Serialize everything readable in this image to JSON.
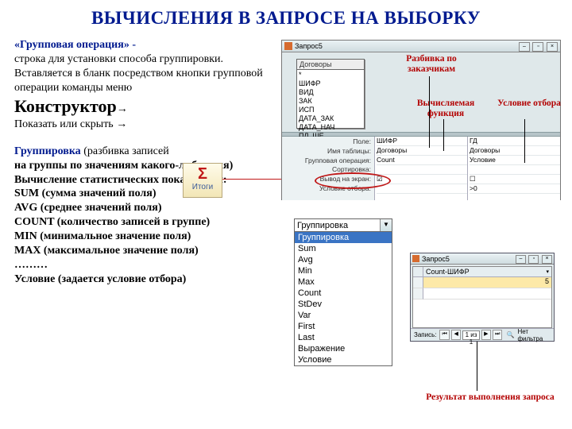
{
  "title": "ВЫЧИСЛЕНИЯ В ЗАПРОСЕ НА ВЫБОРКУ",
  "left": {
    "p1_b": "«Групповая операция» -",
    "p1": "строка для установки способа группировки.",
    "p2": "Вставляется в бланк посредством кнопки групповой операции команды меню",
    "konstructor": "Конструктор",
    "show_hide": "Показать или скрыть",
    "group_b": "Группировка",
    "group_paren": "(разбивка записей",
    "group_cont": "на группы по значениям какого-либо поля)",
    "stat_hdr": "Вычисление статистических показателей:",
    "sum": "SUM (сумма значений поля)",
    "avg": "AVG (среднее значений поля)",
    "count": "COUNT (количество записей в группе)",
    "min": "MIN (минимальное значение поля)",
    "max": "MAX (максимальное значение поля)",
    "dots": "………",
    "cond": "Условие (задается условие отбора)"
  },
  "itogi": {
    "sigma": "Σ",
    "label": "Итоги"
  },
  "app": {
    "title": "Запрос5",
    "fieldbox_title": "Договоры",
    "fields": [
      "*",
      "ШИФР",
      "ВИД",
      "ЗАК",
      "ИСП",
      "ДАТА_ЗАК",
      "ДАТА_НАЧ",
      "ПЛ_ШЕ"
    ],
    "rowlabels": [
      "Поле:",
      "Имя таблицы:",
      "Групповая операция:",
      "Сортировка:",
      "Вывод на экран:",
      "Условие отбора:"
    ],
    "col1": [
      "ШИФР",
      "Договоры",
      "Count",
      "",
      "☑",
      ""
    ],
    "col2": [
      "ГД",
      "Договоры",
      "Условие",
      "",
      "☐",
      ">0"
    ]
  },
  "annotations": {
    "a1": "Разбивка по заказчикам",
    "a2": "Вычисляемая функция",
    "a3": "Условие отбора",
    "a4": "Результат выполнения запроса"
  },
  "dropdown": {
    "selected": "Группировка",
    "options": [
      "Группировка",
      "Sum",
      "Avg",
      "Min",
      "Max",
      "Count",
      "StDev",
      "Var",
      "First",
      "Last",
      "Выражение",
      "Условие"
    ]
  },
  "result": {
    "title": "Запрос5",
    "col_header": "Count-ШИФР",
    "value": "5",
    "nav_label": "Запись:",
    "nav_of": "1 из 1",
    "nofilter": "Нет фильтра"
  }
}
